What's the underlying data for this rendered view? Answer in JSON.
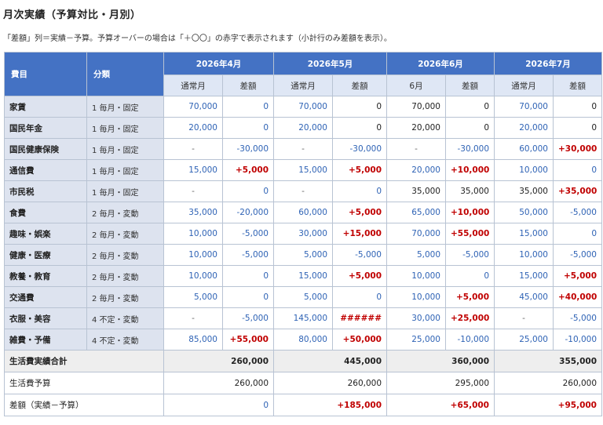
{
  "title": "月次実績（予算対比・月別）",
  "note": "「差額」列＝実績－予算。予算オーバーの場合は「＋〇〇」の赤字で表示されます（小計行のみ差額を表示）。",
  "colors": {
    "header": "#4472c4",
    "subheader": "#dfe7f5",
    "label_bg": "#dde3ef",
    "over": "#c00000",
    "budget": "#2f63b5"
  },
  "header": {
    "item": "費目",
    "category": "分類",
    "months": [
      {
        "label": "2026年4月",
        "sub1": "通常月",
        "sub2": "差額"
      },
      {
        "label": "2026年5月",
        "sub1": "通常月",
        "sub2": "差額"
      },
      {
        "label": "2026年6月",
        "sub1": "6月",
        "sub2": "差額"
      },
      {
        "label": "2026年7月",
        "sub1": "通常月",
        "sub2": "差額"
      }
    ]
  },
  "rows": [
    {
      "name": "家賃",
      "cat": "1 毎月・固定",
      "cells": [
        [
          "70,000",
          "b"
        ],
        [
          "0",
          "b"
        ],
        [
          "70,000",
          "b"
        ],
        [
          "0",
          "n"
        ],
        [
          "70,000",
          "n"
        ],
        [
          "0",
          "n"
        ],
        [
          "70,000",
          "b"
        ],
        [
          "0",
          "n"
        ]
      ]
    },
    {
      "name": "国民年金",
      "cat": "1 毎月・固定",
      "cells": [
        [
          "20,000",
          "b"
        ],
        [
          "0",
          "b"
        ],
        [
          "20,000",
          "b"
        ],
        [
          "0",
          "n"
        ],
        [
          "20,000",
          "n"
        ],
        [
          "0",
          "n"
        ],
        [
          "20,000",
          "b"
        ],
        [
          "0",
          "n"
        ]
      ]
    },
    {
      "name": "国民健康保険",
      "cat": "1 毎月・固定",
      "cells": [
        [
          "-",
          "dc"
        ],
        [
          "-30,000",
          "b"
        ],
        [
          "-",
          "dc"
        ],
        [
          "-30,000",
          "b"
        ],
        [
          "-",
          "dc"
        ],
        [
          "-30,000",
          "b"
        ],
        [
          "60,000",
          "b"
        ],
        [
          "+30,000",
          "r"
        ]
      ]
    },
    {
      "name": "通信費",
      "cat": "1 毎月・固定",
      "cells": [
        [
          "15,000",
          "b"
        ],
        [
          "+5,000",
          "r"
        ],
        [
          "15,000",
          "b"
        ],
        [
          "+5,000",
          "r"
        ],
        [
          "20,000",
          "b"
        ],
        [
          "+10,000",
          "r"
        ],
        [
          "10,000",
          "b"
        ],
        [
          "0",
          "b"
        ]
      ]
    },
    {
      "name": "市民税",
      "cat": "1 毎月・固定",
      "cells": [
        [
          "-",
          "dc"
        ],
        [
          "0",
          "b"
        ],
        [
          "-",
          "dc"
        ],
        [
          "0",
          "b"
        ],
        [
          "35,000",
          "n"
        ],
        [
          "35,000",
          "n"
        ],
        [
          "35,000",
          "n"
        ],
        [
          "+35,000",
          "r"
        ]
      ]
    },
    {
      "name": "食費",
      "cat": "2 毎月・変動",
      "cells": [
        [
          "35,000",
          "b"
        ],
        [
          "-20,000",
          "b"
        ],
        [
          "60,000",
          "b"
        ],
        [
          "+5,000",
          "r"
        ],
        [
          "65,000",
          "b"
        ],
        [
          "+10,000",
          "r"
        ],
        [
          "50,000",
          "b"
        ],
        [
          "-5,000",
          "b"
        ]
      ]
    },
    {
      "name": "趣味・娯楽",
      "cat": "2 毎月・変動",
      "cells": [
        [
          "10,000",
          "b"
        ],
        [
          "-5,000",
          "b"
        ],
        [
          "30,000",
          "b"
        ],
        [
          "+15,000",
          "r"
        ],
        [
          "70,000",
          "b"
        ],
        [
          "+55,000",
          "r"
        ],
        [
          "15,000",
          "b"
        ],
        [
          "0",
          "b"
        ]
      ]
    },
    {
      "name": "健康・医療",
      "cat": "2 毎月・変動",
      "cells": [
        [
          "10,000",
          "b"
        ],
        [
          "-5,000",
          "b"
        ],
        [
          "5,000",
          "b"
        ],
        [
          "-5,000",
          "b"
        ],
        [
          "5,000",
          "b"
        ],
        [
          "-5,000",
          "b"
        ],
        [
          "10,000",
          "b"
        ],
        [
          "-5,000",
          "b"
        ]
      ]
    },
    {
      "name": "教養・教育",
      "cat": "2 毎月・変動",
      "cells": [
        [
          "10,000",
          "b"
        ],
        [
          "0",
          "b"
        ],
        [
          "15,000",
          "b"
        ],
        [
          "+5,000",
          "r"
        ],
        [
          "10,000",
          "b"
        ],
        [
          "0",
          "b"
        ],
        [
          "15,000",
          "b"
        ],
        [
          "+5,000",
          "r"
        ]
      ]
    },
    {
      "name": "交通費",
      "cat": "2 毎月・変動",
      "cells": [
        [
          "5,000",
          "b"
        ],
        [
          "0",
          "b"
        ],
        [
          "5,000",
          "b"
        ],
        [
          "0",
          "b"
        ],
        [
          "10,000",
          "b"
        ],
        [
          "+5,000",
          "r"
        ],
        [
          "45,000",
          "b"
        ],
        [
          "+40,000",
          "r"
        ]
      ]
    },
    {
      "name": "衣服・美容",
      "cat": "4 不定・変動",
      "cells": [
        [
          "-",
          "dc"
        ],
        [
          "-5,000",
          "b"
        ],
        [
          "145,000",
          "b"
        ],
        [
          "######",
          "r"
        ],
        [
          "30,000",
          "b"
        ],
        [
          "+25,000",
          "r"
        ],
        [
          "-",
          "dc"
        ],
        [
          "-5,000",
          "b"
        ]
      ]
    },
    {
      "name": "雑費・予備",
      "cat": "4 不定・変動",
      "cells": [
        [
          "85,000",
          "b"
        ],
        [
          "+55,000",
          "r"
        ],
        [
          "80,000",
          "b"
        ],
        [
          "+50,000",
          "r"
        ],
        [
          "25,000",
          "b"
        ],
        [
          "-10,000",
          "b"
        ],
        [
          "25,000",
          "b"
        ],
        [
          "-10,000",
          "b"
        ]
      ]
    }
  ],
  "summary": [
    {
      "label": "生活費実績合計",
      "values": [
        [
          "260,000",
          "n"
        ],
        [
          "445,000",
          "n"
        ],
        [
          "360,000",
          "n"
        ],
        [
          "355,000",
          "n"
        ]
      ]
    },
    {
      "label": "生活費予算",
      "values": [
        [
          "260,000",
          "n"
        ],
        [
          "260,000",
          "n"
        ],
        [
          "295,000",
          "n"
        ],
        [
          "260,000",
          "n"
        ]
      ]
    },
    {
      "label": "差額（実績－予算）",
      "values": [
        [
          "0",
          "b"
        ],
        [
          "+185,000",
          "r"
        ],
        [
          "+65,000",
          "r"
        ],
        [
          "+95,000",
          "r"
        ]
      ]
    }
  ]
}
